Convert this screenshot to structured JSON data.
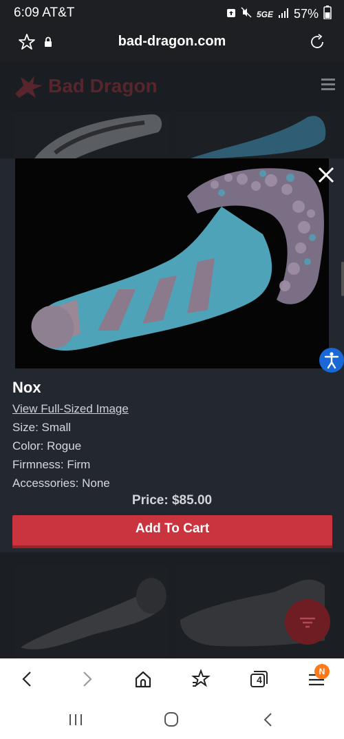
{
  "status_bar": {
    "time": "6:09",
    "carrier": "AT&T",
    "network": "5GE",
    "battery": "57%"
  },
  "address_bar": {
    "url": "bad-dragon.com"
  },
  "site": {
    "logo_text": "Bad Dragon"
  },
  "product": {
    "name": "Nox",
    "view_full_image": "View Full-Sized Image",
    "size": "Size: Small",
    "color": "Color: Rogue",
    "firmness": "Firmness: Firm",
    "accessories": "Accessories: None",
    "price": "Price: $85.00",
    "add_to_cart": "Add To Cart"
  },
  "toolbar": {
    "tab_count": "4",
    "notification_badge": "N"
  },
  "colors": {
    "brand_red": "#c9343e",
    "accessibility_blue": "#1a67d6"
  }
}
